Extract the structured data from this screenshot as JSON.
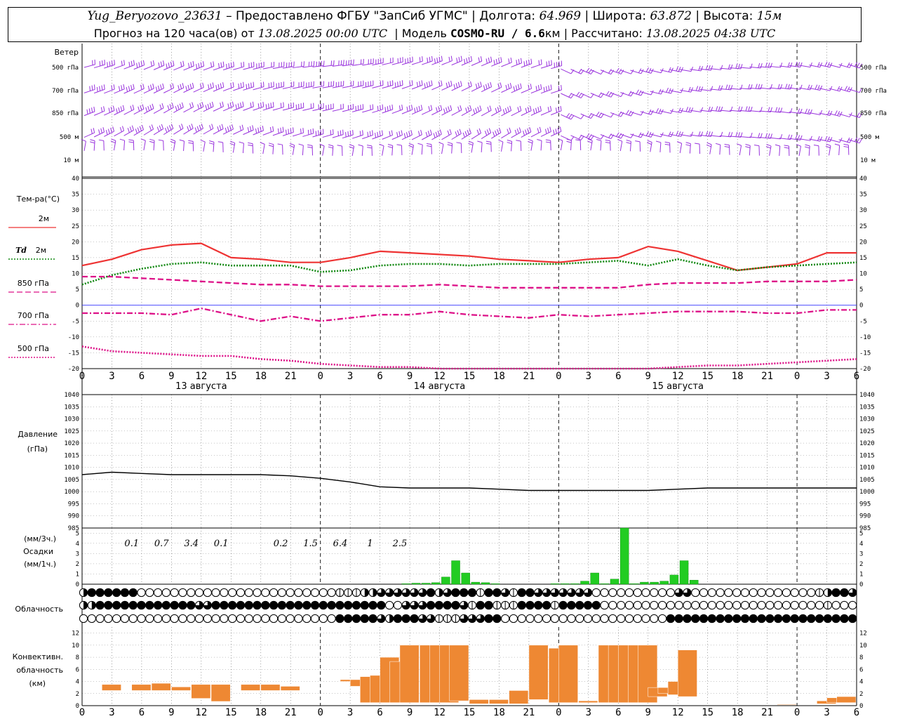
{
  "header": {
    "station": "Yug_Beryozovo_23631",
    "provider": "– Предоставлено ФГБУ \"ЗапСиб УГМС\"",
    "lon_label": "| Долгота:",
    "lon_value": "64.969",
    "lat_label": "| Широта:",
    "lat_value": "63.872",
    "alt_label": "| Высота:",
    "alt_value": "15м",
    "forecast_label": "Прогноз на 120 часа(ов) от",
    "forecast_start": "13.08.2025 00:00 UTC",
    "model_label": "| Модель",
    "model_name": "COSMO-RU / 6.6",
    "model_unit": "км",
    "computed_label": "| Рассчитано:",
    "computed_time": "13.08.2025 04:38 UTC"
  },
  "colors": {
    "wind": "#9933dd",
    "t2m": "#ee3333",
    "td2m": "#118811",
    "t850": "#dd1188",
    "t700": "#dd1188",
    "t500": "#dd1188",
    "zero_line": "#3333ff",
    "pressure": "#000000",
    "precip": "#22cc22",
    "convective": "#ee8833"
  },
  "x_axis": {
    "hour_labels": [
      "0",
      "3",
      "6",
      "9",
      "12",
      "15",
      "18",
      "21",
      "0",
      "3",
      "6",
      "9",
      "12",
      "15",
      "18",
      "21",
      "0",
      "3",
      "6",
      "9",
      "12",
      "15",
      "18",
      "21",
      "0",
      "3",
      "6"
    ],
    "day_labels": [
      "13 августа",
      "14 августа",
      "15 августа"
    ]
  },
  "wind_panel": {
    "title": "Ветер",
    "levels": [
      "500 гПа",
      "700 гПа",
      "850 гПа",
      "500 м",
      "10 м"
    ],
    "right_levels": [
      "500 гПа",
      "700 гПа",
      "850 гПа",
      "500 м",
      "10 м"
    ]
  },
  "temp_panel": {
    "title": "Тем-ра(°C)",
    "legend": [
      {
        "label": "2м",
        "style": "solid"
      },
      {
        "label_italic": "Td",
        "label": "2м",
        "style": "dotted"
      },
      {
        "label": "850 гПа",
        "style": "dashed"
      },
      {
        "label": "700 гПа",
        "style": "dashdot"
      },
      {
        "label": "500 гПа",
        "style": "dotted"
      }
    ],
    "ticks": [
      "40",
      "35",
      "30",
      "25",
      "20",
      "15",
      "10",
      "5",
      "0",
      "-5",
      "-10",
      "-15",
      "-20"
    ]
  },
  "pressure_panel": {
    "title": "Давление",
    "unit": "(гПа)",
    "ticks": [
      "1040",
      "1035",
      "1030",
      "1025",
      "1020",
      "1015",
      "1010",
      "1005",
      "1000",
      "995",
      "990",
      "985"
    ]
  },
  "precip_panel": {
    "unit_top": "(мм/3ч.)",
    "title": "Осадки",
    "unit_bottom": "(мм/1ч.)",
    "ticks": [
      "5",
      "4",
      "3",
      "2",
      "1",
      "0"
    ],
    "labels": [
      {
        "hour": 5,
        "text": "0.1"
      },
      {
        "hour": 8,
        "text": "0.7"
      },
      {
        "hour": 11,
        "text": "3.4"
      },
      {
        "hour": 14,
        "text": "0.1"
      },
      {
        "hour": 20,
        "text": "0.2"
      },
      {
        "hour": 23,
        "text": "1.5"
      },
      {
        "hour": 26,
        "text": "6.4"
      },
      {
        "hour": 29,
        "text": "1"
      },
      {
        "hour": 32,
        "text": "2.5"
      }
    ]
  },
  "cloud_panel": {
    "title": "Облачность"
  },
  "conv_panel": {
    "title_1": "Конвективн.",
    "title_2": "облачность",
    "unit": "(км)",
    "ticks": [
      "12",
      "10",
      "8",
      "6",
      "4",
      "2",
      "0"
    ]
  },
  "chart_data": {
    "type": "line",
    "x_hours": [
      0,
      3,
      6,
      9,
      12,
      15,
      18,
      21,
      24,
      27,
      30,
      33,
      36,
      39,
      42,
      45,
      48,
      51,
      54,
      57,
      60,
      63,
      66,
      69,
      72,
      75,
      78
    ],
    "temperature": {
      "ylim": [
        -20,
        40
      ],
      "series": [
        {
          "name": "2м",
          "values": [
            12.5,
            14.5,
            17.5,
            19,
            19.5,
            15,
            14.5,
            13.5,
            13.5,
            15,
            17,
            16.5,
            16,
            15.5,
            14.5,
            14,
            13.5,
            14.5,
            15,
            18.5,
            17,
            14,
            11,
            12,
            13,
            16.5,
            16.5
          ]
        },
        {
          "name": "Td 2м",
          "values": [
            6.5,
            9.5,
            11.5,
            13,
            13.5,
            12.5,
            12.5,
            12.5,
            10.5,
            11,
            12.5,
            13,
            13,
            12.5,
            13,
            13,
            13,
            13.5,
            14,
            12.5,
            14.5,
            12.5,
            11,
            12,
            12.5,
            13,
            13.5
          ]
        },
        {
          "name": "850 гПа",
          "values": [
            9,
            9,
            8.5,
            8,
            7.5,
            7,
            6.5,
            6.5,
            6,
            6,
            6,
            6,
            6.5,
            6,
            5.5,
            5.5,
            5.5,
            5.5,
            5.5,
            6.5,
            7,
            7,
            7,
            7.5,
            7.5,
            7.5,
            8
          ]
        },
        {
          "name": "700 гПа",
          "values": [
            -2.5,
            -2.5,
            -2.5,
            -3,
            -1,
            -3,
            -5,
            -3.5,
            -5,
            -4,
            -3,
            -3,
            -2,
            -3,
            -3.5,
            -4,
            -3,
            -3.5,
            -3,
            -2.5,
            -2,
            -2,
            -2,
            -2.5,
            -2.5,
            -1.5,
            -1.5
          ]
        },
        {
          "name": "500 гПа",
          "values": [
            -13,
            -14.5,
            -15,
            -15.5,
            -16,
            -16,
            -17,
            -17.5,
            -18.5,
            -19,
            -19.5,
            -19.5,
            -20,
            -20,
            -20,
            -20,
            -20,
            -20,
            -20,
            -20,
            -19.5,
            -19,
            -19,
            -18.5,
            -18,
            -17.5,
            -17
          ]
        }
      ]
    },
    "pressure": {
      "ylim": [
        985,
        1040
      ],
      "values": [
        1007,
        1008,
        1007.5,
        1007,
        1007,
        1007,
        1007,
        1006.5,
        1005.5,
        1004,
        1002,
        1001.5,
        1001.5,
        1001.5,
        1001,
        1000.5,
        1000.5,
        1000.5,
        1000.5,
        1000.5,
        1001,
        1001.5,
        1001.5,
        1001.5,
        1001.5,
        1001.5,
        1001.5
      ]
    },
    "precip_hourly": {
      "ylim": [
        0,
        5.5
      ],
      "bars": [
        [
          33,
          0.05
        ],
        [
          34,
          0.1
        ],
        [
          35,
          0.1
        ],
        [
          36,
          0.15
        ],
        [
          37,
          0.7
        ],
        [
          38,
          2.3
        ],
        [
          39,
          1.1
        ],
        [
          40,
          0.2
        ],
        [
          41,
          0.15
        ],
        [
          42,
          0.05
        ],
        [
          48,
          0.05
        ],
        [
          49,
          0.05
        ],
        [
          50,
          0.05
        ],
        [
          51,
          0.3
        ],
        [
          52,
          1.1
        ],
        [
          53,
          0.05
        ],
        [
          54,
          0.5
        ],
        [
          55,
          5.8
        ],
        [
          56,
          0.05
        ],
        [
          57,
          0.2
        ],
        [
          58,
          0.2
        ],
        [
          59,
          0.3
        ],
        [
          60,
          0.9
        ],
        [
          61,
          2.3
        ],
        [
          62,
          0.4
        ]
      ]
    },
    "convective_cloud_km": {
      "ylim": [
        0,
        13
      ],
      "bars": [
        [
          3,
          2.5,
          3.5
        ],
        [
          6,
          2.5,
          3.5
        ],
        [
          8,
          2.5,
          3.7
        ],
        [
          10,
          2.5,
          3.1
        ],
        [
          12,
          1.2,
          3.5
        ],
        [
          14,
          0.7,
          3.5
        ],
        [
          17,
          2.5,
          3.5
        ],
        [
          19,
          2.5,
          3.5
        ],
        [
          21,
          2.5,
          3.2
        ],
        [
          27,
          4,
          4.3
        ],
        [
          28,
          3.2,
          4.3
        ],
        [
          29,
          0.5,
          4.8
        ],
        [
          30,
          0.5,
          5
        ],
        [
          31,
          0.5,
          8
        ],
        [
          32,
          0.5,
          7.3
        ],
        [
          33,
          0.5,
          10
        ],
        [
          35,
          0.5,
          10
        ],
        [
          36,
          0.5,
          10
        ],
        [
          37,
          0.5,
          10
        ],
        [
          38,
          0.8,
          10
        ],
        [
          40,
          0.3,
          1
        ],
        [
          42,
          0.3,
          1
        ],
        [
          44,
          0.3,
          2.5
        ],
        [
          46,
          1,
          10
        ],
        [
          47,
          0.5,
          0.5
        ],
        [
          48,
          0.5,
          9.5
        ],
        [
          49,
          0.5,
          10
        ],
        [
          51,
          0.5,
          0.8
        ],
        [
          53,
          0.5,
          10
        ],
        [
          54,
          0.5,
          10
        ],
        [
          55,
          0.5,
          10
        ],
        [
          56,
          0.5,
          10
        ],
        [
          57,
          0.5,
          10
        ],
        [
          58,
          1.5,
          3
        ],
        [
          59,
          2,
          3
        ],
        [
          60,
          1.8,
          4
        ],
        [
          61,
          1.5,
          9.2
        ],
        [
          71,
          0.1,
          0.2
        ],
        [
          75,
          0.3,
          0.8
        ],
        [
          76,
          0.5,
          1.3
        ],
        [
          77,
          0.5,
          1.5
        ]
      ]
    },
    "cloud_rows": {
      "high": "2444444000000000000000000000000111223333334234441443144333333300000000003300000000000000012443",
      "mid": "2244444444444433444444444444444444444003334444314411144441444440000000000000000000000000001000",
      "low": "0000000000000000000000000000000444443244433111333440000000000000000000044444444444444444444444"
    }
  }
}
